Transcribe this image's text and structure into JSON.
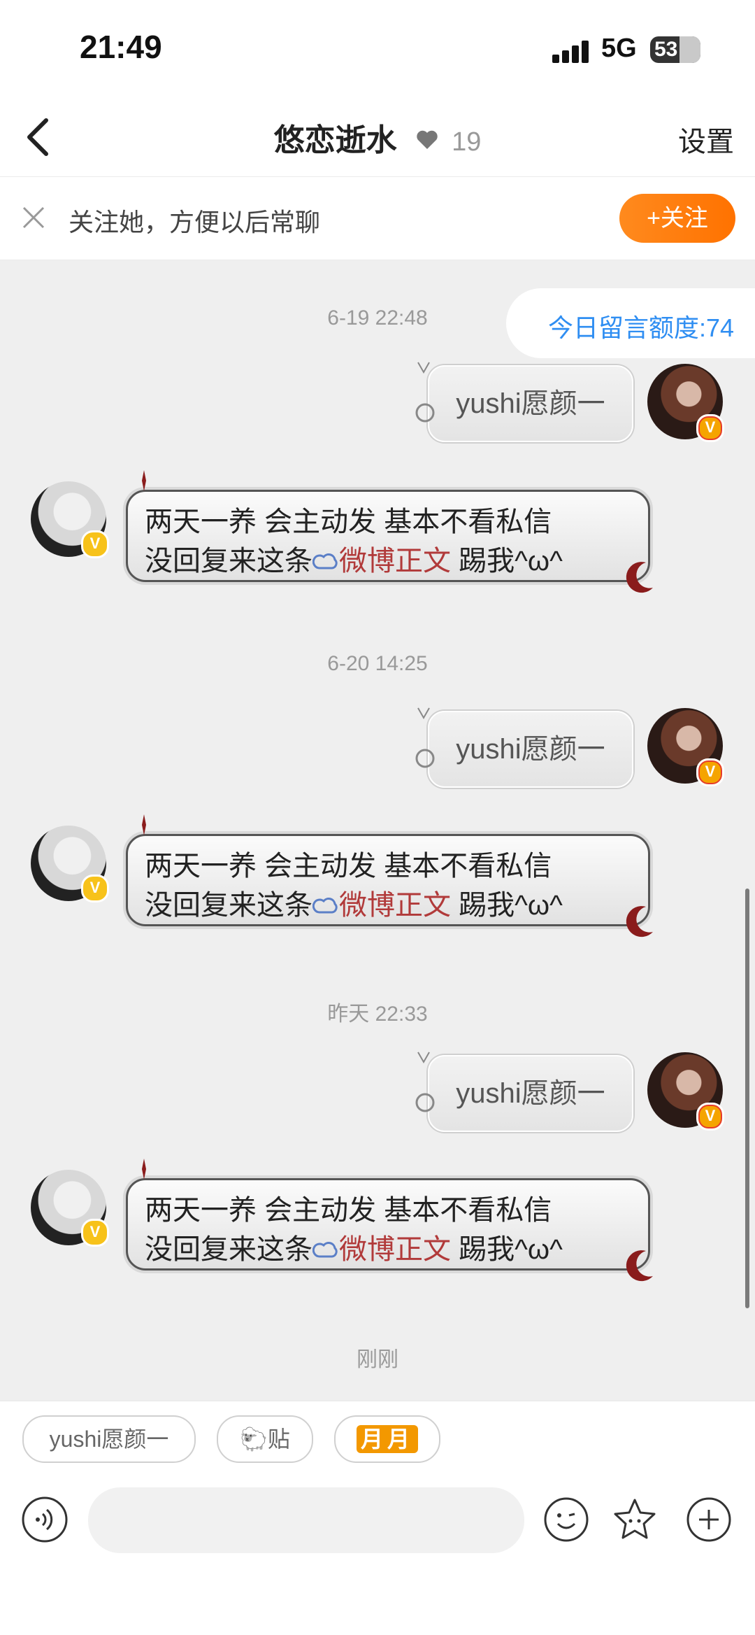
{
  "status_bar": {
    "time": "21:49",
    "network": "5G",
    "battery": "53"
  },
  "nav": {
    "title": "悠恋逝水",
    "heart_count": "19",
    "settings": "设置"
  },
  "follow_bar": {
    "text": "关注她，方便以后常聊",
    "button": "+关注"
  },
  "quota": "今日留言额度:74",
  "messages": [
    {
      "time": "6-19 22:48",
      "sent": "yushi愿颜一",
      "reply_line1": "两天一养 会主动发 基本不看私信",
      "reply_prefix": "没回复来这条",
      "reply_link": "微博正文",
      "reply_suffix": " 踢我^ω^"
    },
    {
      "time": "6-20 14:25",
      "sent": "yushi愿颜一",
      "reply_line1": "两天一养 会主动发 基本不看私信",
      "reply_prefix": "没回复来这条",
      "reply_link": "微博正文",
      "reply_suffix": " 踢我^ω^"
    },
    {
      "time": "昨天 22:33",
      "sent": "yushi愿颜一",
      "reply_line1": "两天一养 会主动发 基本不看私信",
      "reply_prefix": "没回复来这条",
      "reply_link": "微博正文",
      "reply_suffix": " 踢我^ω^"
    }
  ],
  "last_time": "刚刚",
  "quick_replies": [
    "yushi愿颜一",
    "贴",
    "月月"
  ],
  "icons": {
    "back": "chevron-left-icon",
    "heart": "heart-icon",
    "close": "close-icon",
    "voice": "voice-icon",
    "emoji": "emoji-icon",
    "sticker": "star-icon",
    "add": "plus-icon",
    "sheep": "sheep-icon"
  },
  "colors": {
    "accent": "#ff7a00",
    "quota_text": "#2f8ef2",
    "link": "#b13a3a"
  }
}
